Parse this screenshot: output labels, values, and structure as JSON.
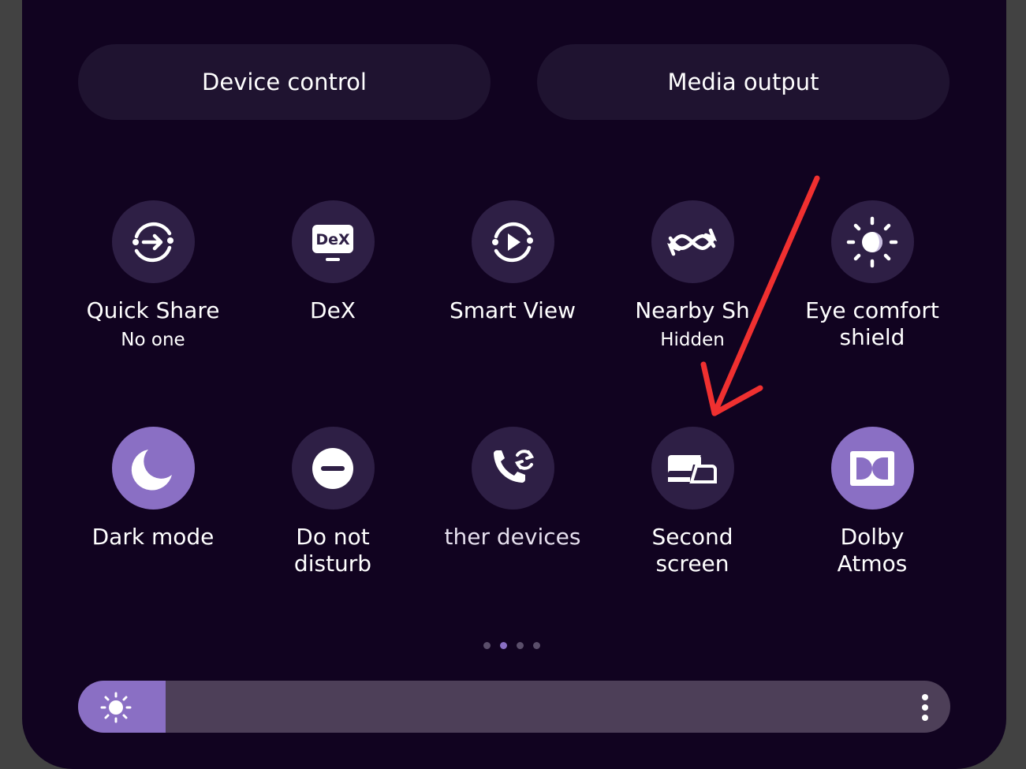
{
  "top_buttons": {
    "device_control": "Device control",
    "media_output": "Media output"
  },
  "tiles_row1": [
    {
      "label": "Quick Share",
      "sub": "No one",
      "icon": "quick-share-icon",
      "active": false
    },
    {
      "label": "DeX",
      "sub": "",
      "icon": "dex-icon",
      "icon_text": "DeX",
      "active": false
    },
    {
      "label": "Smart View",
      "sub": "",
      "icon": "smart-view-icon",
      "active": false
    },
    {
      "label": "Nearby Sh",
      "sub": "Hidden",
      "icon": "nearby-share-icon",
      "active": false
    },
    {
      "label": "Eye comfort\nshield",
      "sub": "",
      "icon": "eye-comfort-icon",
      "active": false
    }
  ],
  "tiles_row2": [
    {
      "label": "Dark mode",
      "sub": "",
      "icon": "moon-icon",
      "active": true
    },
    {
      "label": "Do not\ndisturb",
      "sub": "",
      "icon": "do-not-disturb-icon",
      "active": false
    },
    {
      "label": "ther devices",
      "sub": "",
      "icon": "call-sync-icon",
      "active": false
    },
    {
      "label": "Second\nscreen",
      "sub": "",
      "icon": "second-screen-icon",
      "active": false
    },
    {
      "label": "Dolby\nAtmos",
      "sub": "",
      "icon": "dolby-icon",
      "active": true
    }
  ],
  "page_indicator": {
    "pages": 4,
    "current": 2
  },
  "brightness": {
    "level": 0.1,
    "icon": "sun-icon"
  },
  "colors": {
    "panel": "#110320",
    "accent": "#8a6fc4",
    "tile": "#2e1f45",
    "annotation": "#f03030"
  }
}
